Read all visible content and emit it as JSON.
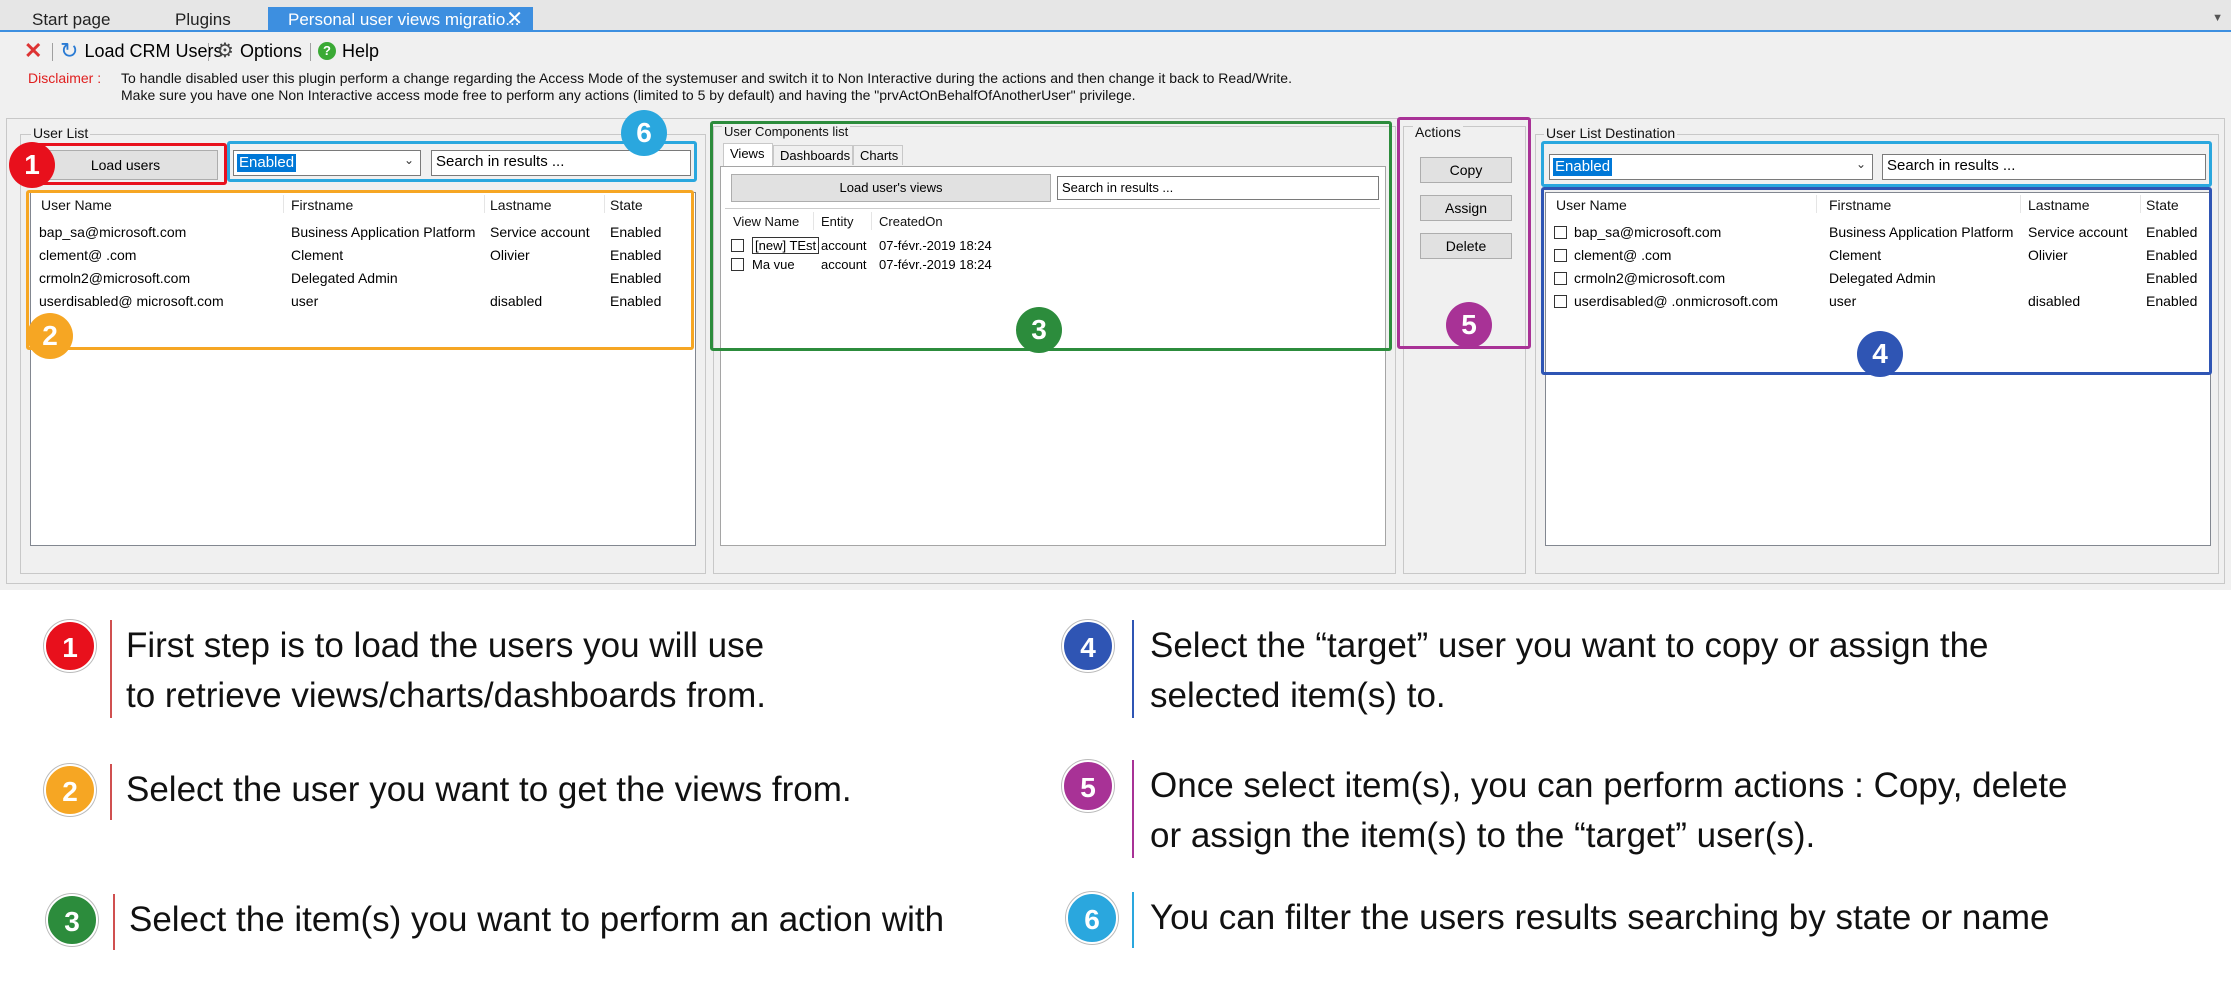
{
  "tabs": [
    {
      "label": "Start page"
    },
    {
      "label": "Plugins"
    },
    {
      "label": "Personal user views migratio...",
      "close": "✕"
    }
  ],
  "toolbar": {
    "close_icon": "close-icon",
    "load_crm_users": "Load CRM Users",
    "options": "Options",
    "help": "Help"
  },
  "disclaimer": {
    "label": "Disclaimer :",
    "line1": "To handle disabled user this plugin perform a change regarding the Access Mode of the systemuser and switch it to Non Interactive during the actions and then change it back to Read/Write.",
    "line2": "Make sure you have one Non Interactive access mode free to perform any actions (limited to 5 by default) and having the \"prvActOnBehalfOfAnotherUser\" privilege."
  },
  "user_list": {
    "group_label": "User List",
    "load_button": "Load users",
    "filter_value": "Enabled",
    "search_placeholder": "Search in results ...",
    "columns": [
      "User Name",
      "Firstname",
      "Lastname",
      "State"
    ],
    "rows": [
      [
        "bap_sa@microsoft.com",
        "Business Application Platform",
        "Service account",
        "Enabled"
      ],
      [
        "clement@          .com",
        "Clement",
        "Olivier",
        "Enabled"
      ],
      [
        "crmoln2@microsoft.com",
        "Delegated Admin",
        "",
        "Enabled"
      ],
      [
        "userdisabled@             microsoft.com",
        "user",
        "disabled",
        "Enabled"
      ]
    ]
  },
  "components": {
    "group_label": "User Components list",
    "tabs": [
      "Views",
      "Dashboards",
      "Charts"
    ],
    "load_button": "Load user's views",
    "search_placeholder": "Search in results ...",
    "columns": [
      "View Name",
      "Entity",
      "CreatedOn"
    ],
    "rows": [
      [
        "[new] TEst",
        "account",
        "07-févr.-2019 18:24"
      ],
      [
        "Ma vue",
        "account",
        "07-févr.-2019 18:24"
      ]
    ]
  },
  "actions": {
    "group_label": "Actions",
    "copy": "Copy",
    "assign": "Assign",
    "delete": "Delete"
  },
  "destination": {
    "group_label": "User List Destination",
    "filter_value": "Enabled",
    "search_placeholder": "Search in results ...",
    "columns": [
      "User Name",
      "Firstname",
      "Lastname",
      "State"
    ],
    "rows": [
      [
        "bap_sa@microsoft.com",
        "Business Application Platform",
        "Service account",
        "Enabled"
      ],
      [
        "clement@          .com",
        "Clement",
        "Olivier",
        "Enabled"
      ],
      [
        "crmoln2@microsoft.com",
        "Delegated Admin",
        "",
        "Enabled"
      ],
      [
        "userdisabled@          .onmicrosoft.com",
        "user",
        "disabled",
        "Enabled"
      ]
    ]
  },
  "badges": {
    "b1": "1",
    "b2": "2",
    "b3": "3",
    "b4": "4",
    "b5": "5",
    "b6": "6"
  },
  "colors": {
    "step1": "#e8101c",
    "step2": "#f6a623",
    "step3": "#2c8c3c",
    "step4": "#2f55b4",
    "step5": "#a83296",
    "step6": "#2aa7de"
  },
  "legend": {
    "s1_line1": "First step is to load the users you will use",
    "s1_line2": "to retrieve views/charts/dashboards from.",
    "s2": "Select the user you want to get the views from.",
    "s3": "Select the item(s) you want to perform an action with",
    "s4_line1": "Select the “target” user you want to copy or assign the",
    "s4_line2": "selected item(s) to.",
    "s5_line1": "Once select item(s), you can perform actions : Copy, delete",
    "s5_line2": "or assign the item(s) to the “target” user(s).",
    "s6": "You can filter the users results searching by state or name"
  }
}
